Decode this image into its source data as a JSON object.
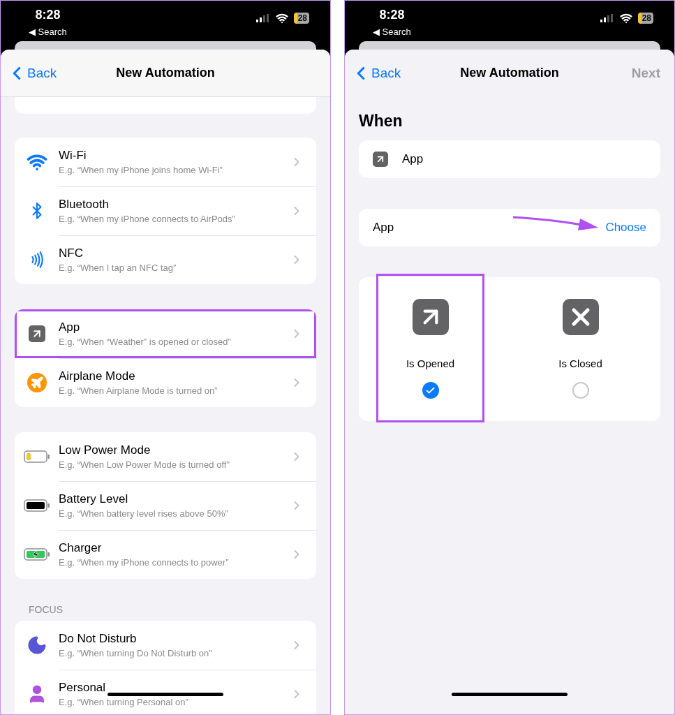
{
  "left_screen": {
    "status_bar": {
      "time": "8:28",
      "back_app": "◀ Search",
      "battery": "28"
    },
    "nav": {
      "back": "Back",
      "title": "New Automation"
    },
    "groups": [
      {
        "items": [
          {
            "kind": "wifi",
            "title": "Wi-Fi",
            "subtitle": "E.g. “When my iPhone joins home Wi-Fi”",
            "highlighted": false
          },
          {
            "kind": "bluetooth",
            "title": "Bluetooth",
            "subtitle": "E.g. “When my iPhone connects to AirPods”",
            "highlighted": false
          },
          {
            "kind": "nfc",
            "title": "NFC",
            "subtitle": "E.g. “When I tap an NFC tag”",
            "highlighted": false
          }
        ]
      },
      {
        "items": [
          {
            "kind": "app",
            "title": "App",
            "subtitle": "E.g. “When “Weather” is opened or closed”",
            "highlighted": true
          },
          {
            "kind": "airplane",
            "title": "Airplane Mode",
            "subtitle": "E.g. “When Airplane Mode is turned on”",
            "highlighted": false
          }
        ]
      },
      {
        "items": [
          {
            "kind": "low_power",
            "title": "Low Power Mode",
            "subtitle": "E.g. “When Low Power Mode is turned off”",
            "highlighted": false
          },
          {
            "kind": "battery",
            "title": "Battery Level",
            "subtitle": "E.g. “When battery level rises above 50%”",
            "highlighted": false
          },
          {
            "kind": "charger",
            "title": "Charger",
            "subtitle": "E.g. “When my iPhone connects to power”",
            "highlighted": false
          }
        ]
      },
      {
        "header": "FOCUS",
        "items": [
          {
            "kind": "moon",
            "title": "Do Not Disturb",
            "subtitle": "E.g. “When turning Do Not Disturb on”",
            "highlighted": false
          },
          {
            "kind": "person",
            "title": "Personal",
            "subtitle": "E.g. “When turning Personal on”",
            "highlighted": false
          }
        ]
      }
    ]
  },
  "right_screen": {
    "status_bar": {
      "time": "8:28",
      "back_app": "◀ Search",
      "battery": "28"
    },
    "nav": {
      "back": "Back",
      "title": "New Automation",
      "next": "Next",
      "next_disabled": true
    },
    "section_title": "When",
    "trigger": {
      "label": "App"
    },
    "app_row": {
      "label": "App",
      "action": "Choose",
      "annotation_arrow": true
    },
    "options": [
      {
        "kind": "opened",
        "label": "Is Opened",
        "selected": true,
        "highlighted": true
      },
      {
        "kind": "closed",
        "label": "Is Closed",
        "selected": false,
        "highlighted": false
      }
    ]
  }
}
